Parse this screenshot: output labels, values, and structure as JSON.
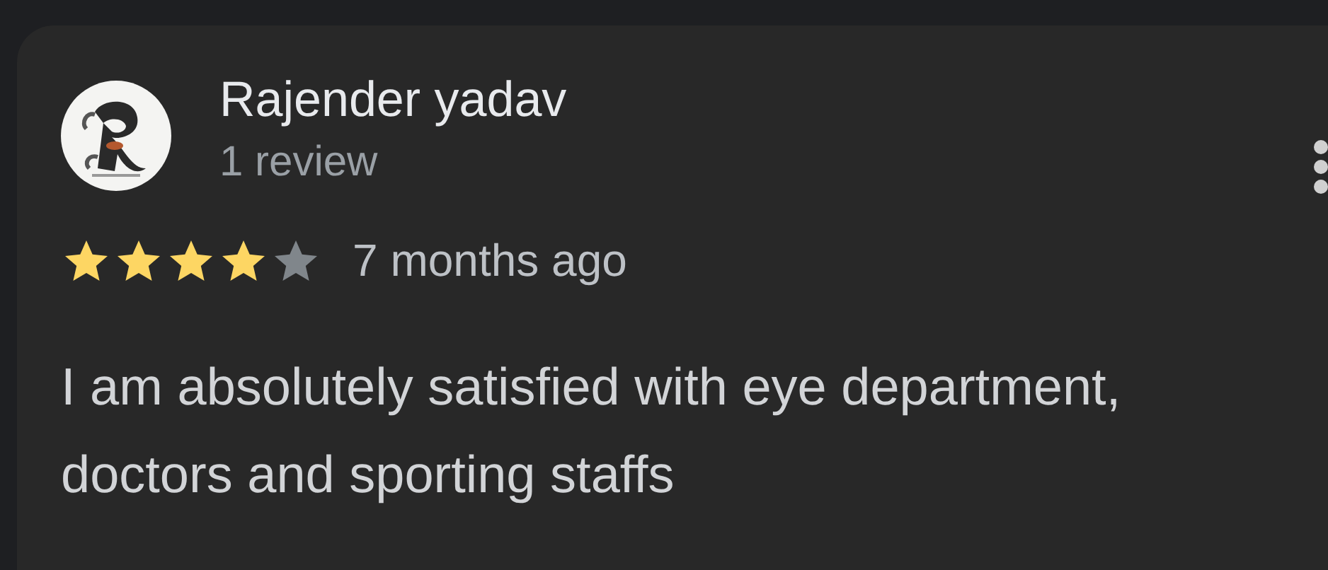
{
  "review": {
    "author": "Rajender yadav",
    "review_count": "1 review",
    "stars": 4,
    "time": "7 months ago",
    "text": "I am absolutely satisfied with eye department, doctors and sporting staffs"
  }
}
